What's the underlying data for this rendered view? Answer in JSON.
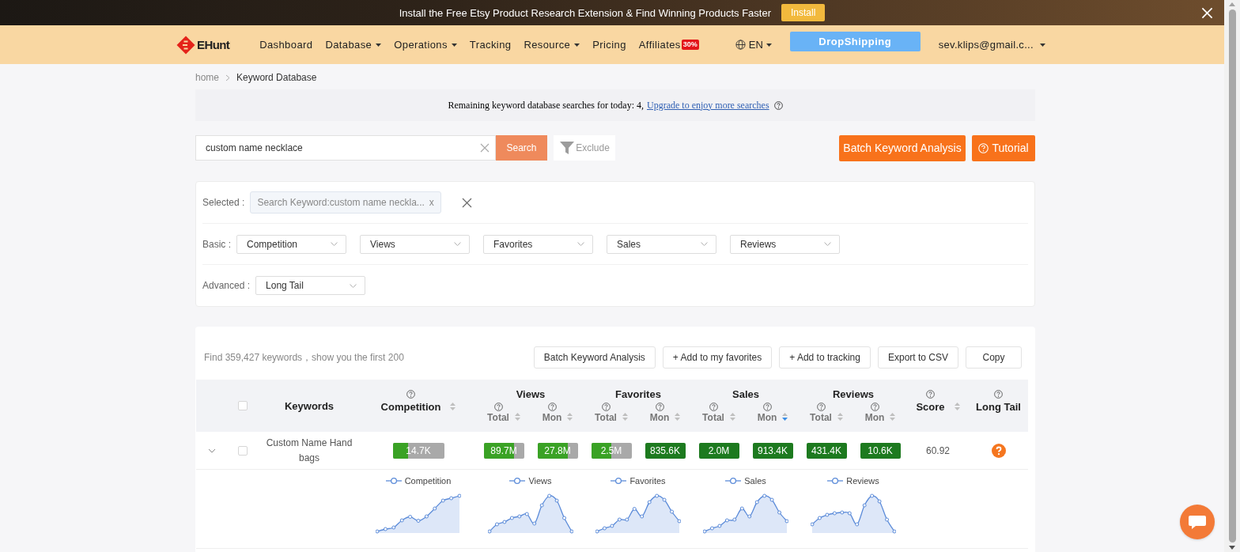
{
  "banner": {
    "message": "Install the Free Etsy Product Research Extension & Find Winning Products Faster",
    "install_button": "Install"
  },
  "nav": {
    "logo": "EHunt",
    "items": [
      {
        "label": "Dashboard",
        "dropdown": false
      },
      {
        "label": "Database",
        "dropdown": true
      },
      {
        "label": "Operations",
        "dropdown": true
      },
      {
        "label": "Tracking",
        "dropdown": false
      },
      {
        "label": "Resource",
        "dropdown": true
      },
      {
        "label": "Pricing",
        "dropdown": false
      },
      {
        "label": "Affiliates",
        "dropdown": false,
        "badge": "30%"
      }
    ],
    "language": "EN",
    "dropshipping_button": "DropShipping",
    "account": "sev.klips@gmail.c..."
  },
  "breadcrumb": [
    {
      "label": "home",
      "current": false
    },
    {
      "label": "Keyword Database",
      "current": true
    }
  ],
  "notice": {
    "text": "Remaining keyword database searches for today: 4,",
    "link": "Upgrade to enjoy more searches"
  },
  "search": {
    "value": "custom name necklace",
    "search_button": "Search",
    "exclude_button": "Exclude",
    "batch_button": "Batch Keyword Analysis",
    "tutorial_button": "Tutorial"
  },
  "filters": {
    "selected": {
      "label": "Selected :",
      "tags": [
        {
          "text": "Search Keyword:custom name neckla...",
          "remove": "x"
        }
      ]
    },
    "basic": {
      "label": "Basic :",
      "selects": [
        "Competition",
        "Views",
        "Favorites",
        "Sales",
        "Reviews"
      ]
    },
    "advanced": {
      "label": "Advanced :",
      "selects": [
        "Long Tail"
      ]
    }
  },
  "results": {
    "summary": "Find 359,427 keywords，show you the first 200",
    "actions": [
      "Batch Keyword Analysis",
      "+ Add to my favorites",
      "+ Add to tracking",
      "Export to CSV",
      "Copy"
    ],
    "table": {
      "select_all": false,
      "columns": [
        {
          "label": "Keywords"
        },
        {
          "label": "Competition",
          "help": true,
          "sortable": true,
          "sorted_desc": false
        },
        {
          "label": "Views",
          "subcolumns": [
            {
              "label": "Total",
              "help": true,
              "sortable": true,
              "sorted_desc": false
            },
            {
              "label": "Mon",
              "help": true,
              "sortable": true,
              "sorted_desc": false
            }
          ]
        },
        {
          "label": "Favorites",
          "subcolumns": [
            {
              "label": "Total",
              "help": true,
              "sortable": true,
              "sorted_desc": false
            },
            {
              "label": "Mon",
              "help": true,
              "sortable": true,
              "sorted_desc": false
            }
          ]
        },
        {
          "label": "Sales",
          "subcolumns": [
            {
              "label": "Total",
              "help": true,
              "sortable": true,
              "sorted_desc": false
            },
            {
              "label": "Mon",
              "help": true,
              "sortable": true,
              "sorted_desc": true
            }
          ]
        },
        {
          "label": "Reviews",
          "subcolumns": [
            {
              "label": "Total",
              "help": true,
              "sortable": true,
              "sorted_desc": false
            },
            {
              "label": "Mon",
              "help": true,
              "sortable": true,
              "sorted_desc": false
            }
          ]
        },
        {
          "label": "Score",
          "help": true,
          "sortable": true,
          "sorted_desc": false
        },
        {
          "label": "Long Tail",
          "help": true
        }
      ],
      "rows": [
        {
          "expanded": true,
          "checked": false,
          "keyword": "Custom Name Hand bags",
          "bars": [
            {
              "value": "14.7K",
              "level": 0.3
            },
            {
              "value": "89.7M",
              "level": 0.75
            },
            {
              "value": "27.8M",
              "level": 0.76
            },
            {
              "value": "2.5M",
              "level": 0.5
            },
            {
              "value": "835.6K",
              "level": 1
            },
            {
              "value": "2.0M",
              "level": 1
            },
            {
              "value": "913.4K",
              "level": 1
            },
            {
              "value": "431.4K",
              "level": 1
            },
            {
              "value": "10.6K",
              "level": 1
            }
          ],
          "score": "60.92",
          "trends": [
            "Competition",
            "Views",
            "Favorites",
            "Sales",
            "Reviews"
          ]
        }
      ]
    }
  }
}
